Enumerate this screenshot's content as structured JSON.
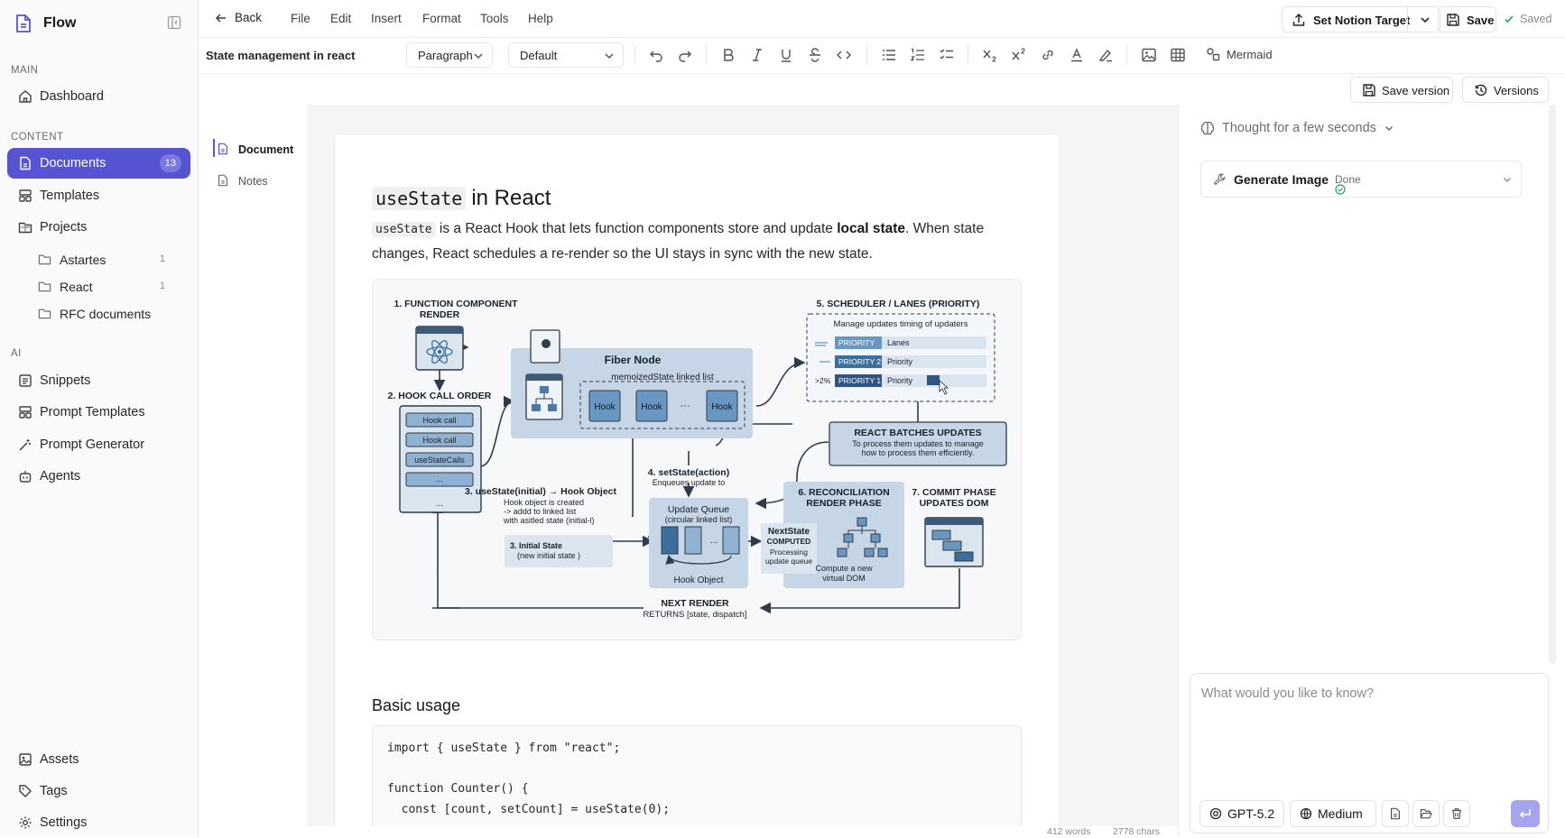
{
  "app": {
    "name": "Flow"
  },
  "sidebar": {
    "main_label": "MAIN",
    "content_label": "CONTENT",
    "ai_label": "AI",
    "dashboard": "Dashboard",
    "documents": {
      "label": "Documents",
      "count": "13"
    },
    "templates": "Templates",
    "projects": "Projects",
    "project_items": [
      {
        "label": "Astartes",
        "count": "1"
      },
      {
        "label": "React",
        "count": "1"
      },
      {
        "label": "RFC documents",
        "count": ""
      }
    ],
    "snippets": "Snippets",
    "prompt_templates": "Prompt Templates",
    "prompt_generator": "Prompt Generator",
    "agents": "Agents",
    "assets": "Assets",
    "tags": "Tags",
    "settings": "Settings"
  },
  "menubar": {
    "back": "Back",
    "menus": [
      "File",
      "Edit",
      "Insert",
      "Format",
      "Tools",
      "Help"
    ],
    "set_notion_target": "Set Notion Target",
    "save": "Save",
    "saved": "Saved"
  },
  "toolbar": {
    "doc_title": "State management in react",
    "block_type": "Paragraph",
    "font": "Default",
    "mermaid": "Mermaid"
  },
  "versions": {
    "save_version": "Save version",
    "versions": "Versions"
  },
  "outline": {
    "document": "Document",
    "notes": "Notes"
  },
  "document": {
    "h1_code": "useState",
    "h1_rest": "in React",
    "p_code": "useState",
    "p_text1": " is a React Hook that lets function components store and update ",
    "p_bold": "local state",
    "p_text2": ". When state changes, React schedules a re-render so the UI stays in sync with the new state.",
    "h2": "Basic usage",
    "code": "import { useState } from \"react\";\n\nfunction Counter() {\n  const [count, setCount] = useState(0);"
  },
  "diagram": {
    "s1a": "1. FUNCTION COMPONENT",
    "s1b": "RENDER",
    "s2": "2. HOOK CALL ORDER",
    "hook_call_1": "Hook call",
    "hook_call_2": "Hook call",
    "use_state_calls": "useStateCalls",
    "dots_box": "...",
    "dots_below": "...",
    "fiber_node": "Fiber Node",
    "memoized": "memoizedState linked list",
    "hook_1": "Hook",
    "hook_2": "Hook",
    "hook_dots": "···",
    "hook_3": "Hook",
    "s3a": "3. useState(initial) → Hook Object",
    "s3b": "Hook object is created",
    "s3c": "-> addd to linked list",
    "s3d": "with asitled state (initial-l)",
    "initial_a": "3. Initial State",
    "initial_b": "(new initial state )",
    "s4a": "4. setState(action)",
    "s4b": "Enqueues update to",
    "uq_a": "Update Queue",
    "uq_b": "(circular linked list)",
    "uq_dots": "...",
    "hook_object": "Hook Object",
    "s5": "5. SCHEDULER / LANES (PRIORITY)",
    "manage": "Manage updates timing of updaters",
    "p_tag1": "PRIORITY",
    "p_val1": "Lanes",
    "p_tag2": "PRIORITY 2",
    "p_val2": "Priority",
    "p_tag3": "PRIORITY 1",
    "p_val3": "Priority",
    "p_pct": ">2%",
    "batch_a": "REACT BATCHES UPDATES",
    "batch_b": "To process them updates to manage",
    "batch_c": "how to process them efficiently.",
    "s6a": "6. RECONCILIATION",
    "s6b": "RENDER PHASE",
    "ns_a": "NextState",
    "ns_b": "COMPUTED",
    "ns_c": "Processing",
    "ns_d": "update queue",
    "cmp_a": "Compute a new",
    "cmp_b": "virtual DOM",
    "s7a": "7. COMMIT PHASE",
    "s7b": "UPDATES DOM",
    "next_a": "NEXT RENDER",
    "next_b": "RETURNS [state, dispatch]"
  },
  "status": {
    "words": "412 words",
    "chars": "2778 chars"
  },
  "panel": {
    "thought": "Thought for a few seconds",
    "tool_name": "Generate Image",
    "tool_status": "Done",
    "input_placeholder": "What would you like to know?",
    "model": "GPT-5.2",
    "effort": "Medium"
  },
  "colors": {
    "accent": "#5754d4",
    "success": "#22a35a",
    "diagram_blue": "#4d7aa8"
  }
}
